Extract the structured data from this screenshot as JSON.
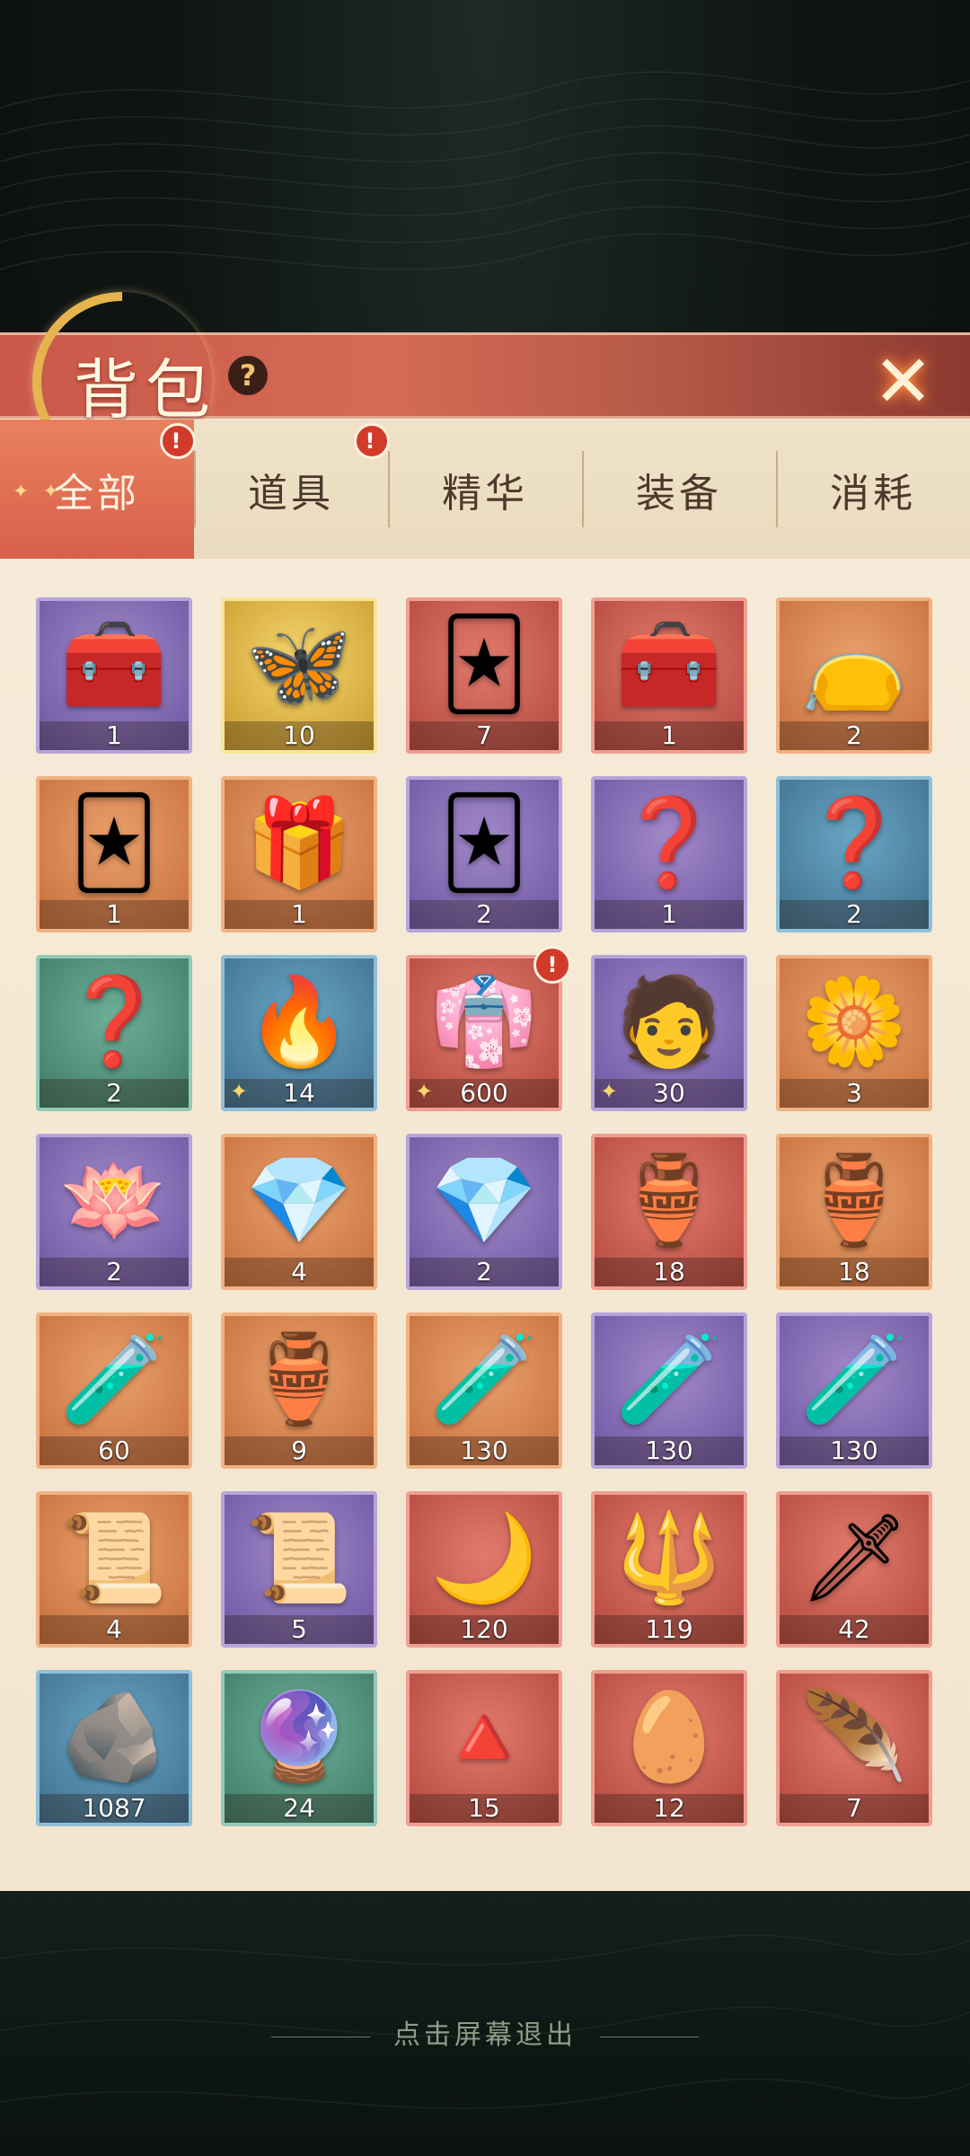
{
  "header": {
    "title": "背包",
    "help_glyph": "?",
    "close_glyph": "✕"
  },
  "tabs": [
    {
      "label": "全部",
      "active": true,
      "badge": "!"
    },
    {
      "label": "道具",
      "active": false,
      "badge": "!"
    },
    {
      "label": "精华",
      "active": false
    },
    {
      "label": "装备",
      "active": false
    },
    {
      "label": "消耗",
      "active": false
    }
  ],
  "items": [
    {
      "icon": "treasure-chest",
      "glyph": "🧰",
      "count": "1",
      "frame": "purple"
    },
    {
      "icon": "butterfly",
      "glyph": "🦋",
      "count": "10",
      "frame": "gold"
    },
    {
      "icon": "card-box",
      "glyph": "🃏",
      "count": "7",
      "frame": "red"
    },
    {
      "icon": "treasure-chest",
      "glyph": "🧰",
      "count": "1",
      "frame": "red"
    },
    {
      "icon": "lucky-bag",
      "glyph": "👝",
      "count": "2",
      "frame": "orange"
    },
    {
      "icon": "card-box",
      "glyph": "🃏",
      "count": "1",
      "frame": "orange"
    },
    {
      "icon": "portrait-box",
      "glyph": "🎁",
      "count": "1",
      "frame": "orange"
    },
    {
      "icon": "card-box",
      "glyph": "🃏",
      "count": "2",
      "frame": "purple"
    },
    {
      "icon": "mystery-box",
      "glyph": "❓",
      "count": "1",
      "frame": "purple"
    },
    {
      "icon": "mystery-box",
      "glyph": "❓",
      "count": "2",
      "frame": "blue"
    },
    {
      "icon": "mystery-box",
      "glyph": "❓",
      "count": "2",
      "frame": "green"
    },
    {
      "icon": "blue-flame",
      "glyph": "🔥",
      "count": "14",
      "frame": "blue",
      "piece": true
    },
    {
      "icon": "character-portrait",
      "glyph": "👘",
      "count": "600",
      "frame": "red",
      "piece": true,
      "badge": "!"
    },
    {
      "icon": "character-portrait",
      "glyph": "🧑",
      "count": "30",
      "frame": "purple",
      "piece": true
    },
    {
      "icon": "blue-flower",
      "glyph": "🌼",
      "count": "3",
      "frame": "orange"
    },
    {
      "icon": "lotus-flower",
      "glyph": "🪷",
      "count": "2",
      "frame": "purple"
    },
    {
      "icon": "crystal",
      "glyph": "💎",
      "count": "4",
      "frame": "orange"
    },
    {
      "icon": "crystal",
      "glyph": "💎",
      "count": "2",
      "frame": "purple"
    },
    {
      "icon": "green-elixir",
      "glyph": "🏺",
      "count": "18",
      "frame": "red"
    },
    {
      "icon": "purple-elixir",
      "glyph": "🏺",
      "count": "18",
      "frame": "orange"
    },
    {
      "icon": "red-potion",
      "glyph": "🧪",
      "count": "60",
      "frame": "orange"
    },
    {
      "icon": "gold-elixir",
      "glyph": "🏺",
      "count": "9",
      "frame": "orange"
    },
    {
      "icon": "green-potion",
      "glyph": "🧪",
      "count": "130",
      "frame": "orange"
    },
    {
      "icon": "purple-potion",
      "glyph": "🧪",
      "count": "130",
      "frame": "purple"
    },
    {
      "icon": "yellow-potion",
      "glyph": "🧪",
      "count": "130",
      "frame": "purple"
    },
    {
      "icon": "gold-scroll",
      "glyph": "📜",
      "count": "4",
      "frame": "orange"
    },
    {
      "icon": "silver-scroll",
      "glyph": "📜",
      "count": "5",
      "frame": "purple"
    },
    {
      "icon": "golden-staff",
      "glyph": "🌙",
      "count": "120",
      "frame": "red"
    },
    {
      "icon": "golden-spear",
      "glyph": "🔱",
      "count": "119",
      "frame": "red"
    },
    {
      "icon": "dagger",
      "glyph": "🗡",
      "count": "42",
      "frame": "red"
    },
    {
      "icon": "ore-stone",
      "glyph": "🪨",
      "count": "1087",
      "frame": "blue"
    },
    {
      "icon": "spirit-stone",
      "glyph": "🔮",
      "count": "24",
      "frame": "green"
    },
    {
      "icon": "salt-crystal",
      "glyph": "🔺",
      "count": "15",
      "frame": "red"
    },
    {
      "icon": "fire-essence",
      "glyph": "🥚",
      "count": "12",
      "frame": "red"
    },
    {
      "icon": "phoenix-feather",
      "glyph": "🪶",
      "count": "7",
      "frame": "red"
    }
  ],
  "footer": {
    "exit_hint": "点击屏幕退出"
  }
}
